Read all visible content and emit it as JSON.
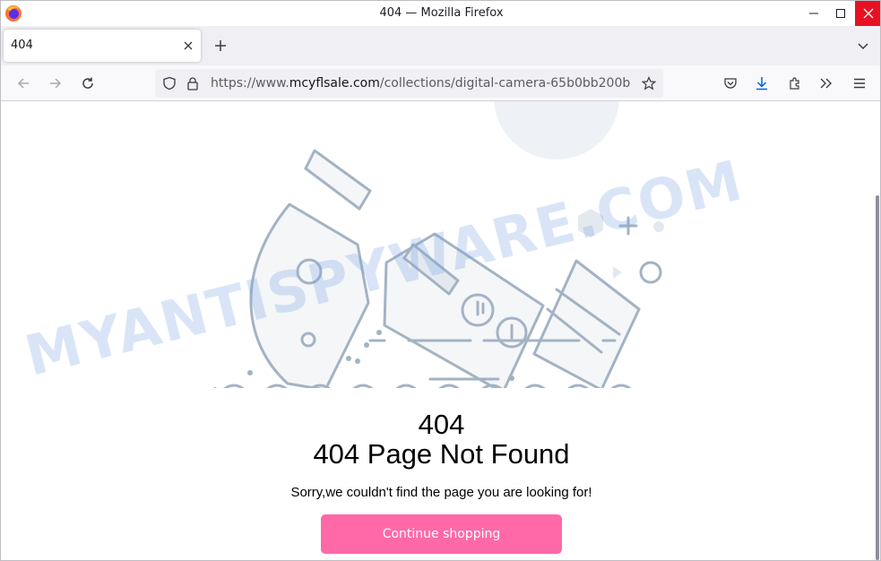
{
  "window": {
    "title": "404 — Mozilla Firefox"
  },
  "tabs": [
    {
      "label": "404"
    }
  ],
  "navbar": {
    "url_prefix": "https://www.",
    "url_host": "mcyflsale.com",
    "url_path": "/collections/digital-camera-65b0bb200b"
  },
  "page": {
    "error_code": "404",
    "heading": "404 Page Not Found",
    "message": "Sorry,we couldn't find the page you are looking for!",
    "button_label": "Continue shopping"
  },
  "watermark": "MYANTISPYWARE.COM",
  "colors": {
    "button_bg": "#ff69a8",
    "close_button_bg": "#e81123",
    "illustration_stroke": "#a3b3c4"
  },
  "icons": [
    "firefox-logo",
    "minimize-icon",
    "maximize-icon",
    "close-icon",
    "tab-close-icon",
    "plus-icon",
    "chevron-down-icon",
    "back-icon",
    "forward-icon",
    "reload-icon",
    "shield-icon",
    "lock-icon",
    "star-icon",
    "pocket-icon",
    "download-icon",
    "extensions-icon",
    "overflow-icon",
    "menu-icon"
  ]
}
